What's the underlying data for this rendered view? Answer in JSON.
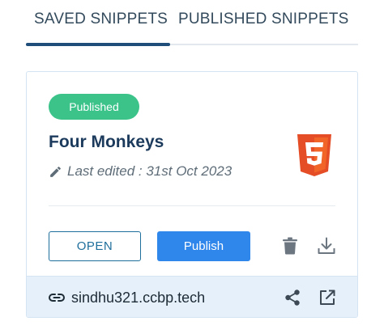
{
  "tabs": {
    "saved_label": "SAVED SNIPPETS",
    "published_label": "PUBLISHED SNIPPETS",
    "active": "saved"
  },
  "snippet": {
    "status_badge": "Published",
    "title": "Four Monkeys",
    "last_edited": "Last edited : 31st Oct 2023",
    "language_icon": "html5-icon",
    "open_label": "OPEN",
    "publish_label": "Publish",
    "url": "sindhu321.ccbp.tech"
  },
  "colors": {
    "accent": "#1f4e7a",
    "badge_green": "#3bc38a",
    "publish_blue": "#2f86eb",
    "html5_orange": "#e44d26",
    "footer_bg": "#e6f0fb"
  },
  "icons": [
    "pencil-icon",
    "html5-icon",
    "trash-icon",
    "download-icon",
    "link-icon",
    "share-icon",
    "external-link-icon"
  ]
}
